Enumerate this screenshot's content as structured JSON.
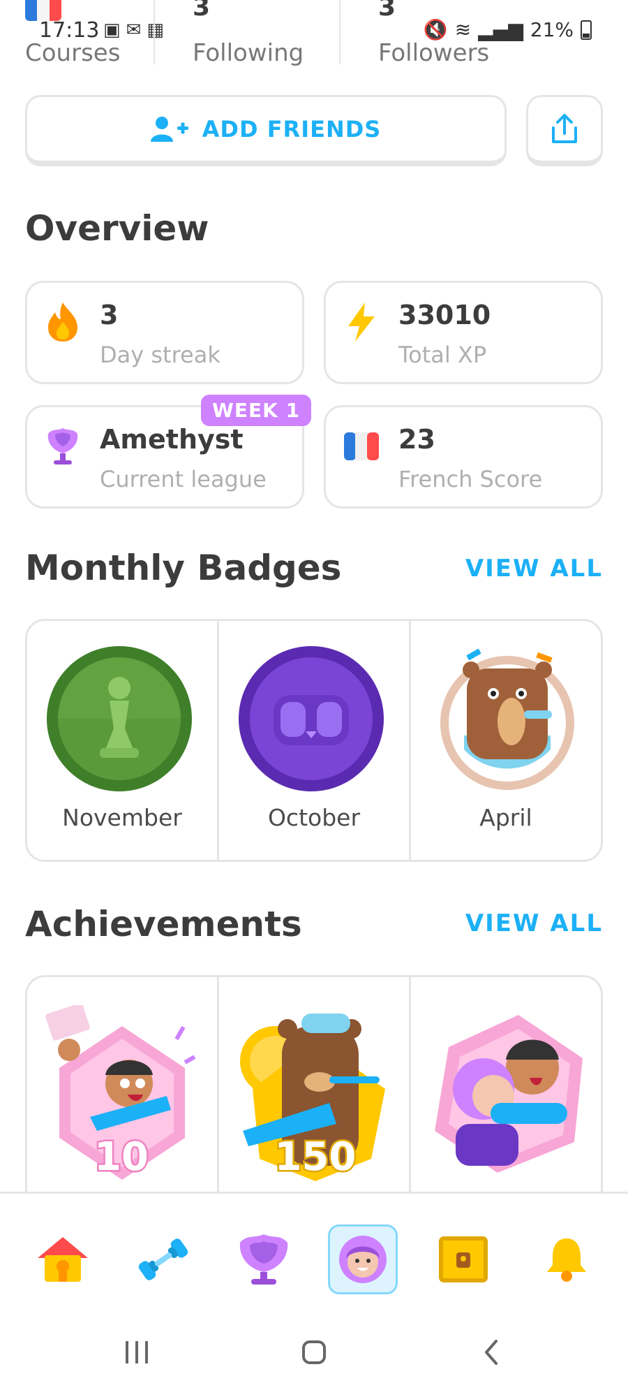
{
  "status_bar": {
    "time": "17:13",
    "battery": "21%"
  },
  "stats": {
    "courses": {
      "value": "",
      "label": "Courses"
    },
    "following": {
      "value": "3",
      "label": "Following"
    },
    "followers": {
      "value": "3",
      "label": "Followers"
    }
  },
  "actions": {
    "add_friends_label": "ADD FRIENDS"
  },
  "overview": {
    "title": "Overview",
    "cards": [
      {
        "value": "3",
        "caption": "Day streak",
        "icon": "flame-icon"
      },
      {
        "value": "33010",
        "caption": "Total XP",
        "icon": "lightning-icon"
      },
      {
        "value": "Amethyst",
        "caption": "Current league",
        "icon": "amethyst-league-icon",
        "badge": "WEEK 1"
      },
      {
        "value": "23",
        "caption": "French Score",
        "icon": "french-flag-icon"
      }
    ]
  },
  "monthly_badges": {
    "title": "Monthly Badges",
    "view_all": "VIEW ALL",
    "items": [
      {
        "label": "November",
        "icon": "chess-pawn-badge-icon"
      },
      {
        "label": "October",
        "icon": "mask-badge-icon"
      },
      {
        "label": "April",
        "icon": "bear-badge-icon"
      }
    ]
  },
  "achievements": {
    "title": "Achievements",
    "view_all": "VIEW ALL",
    "items": [
      {
        "number": "10",
        "icon": "friendly-achievement-icon"
      },
      {
        "number": "150",
        "icon": "bear-achievement-icon"
      },
      {
        "number": "",
        "icon": "hug-achievement-icon"
      }
    ]
  },
  "bottom_nav": {
    "items": [
      "home-icon",
      "practice-dumbbell-icon",
      "leagues-icon",
      "profile-icon",
      "shop-chest-icon",
      "notifications-bell-icon"
    ],
    "active": "profile-icon"
  },
  "colors": {
    "blue": "#1cb0f6",
    "gray_border": "#e5e5e5",
    "amethyst": "#ce82ff",
    "flame": "#ff9600",
    "xp": "#ffc800"
  }
}
